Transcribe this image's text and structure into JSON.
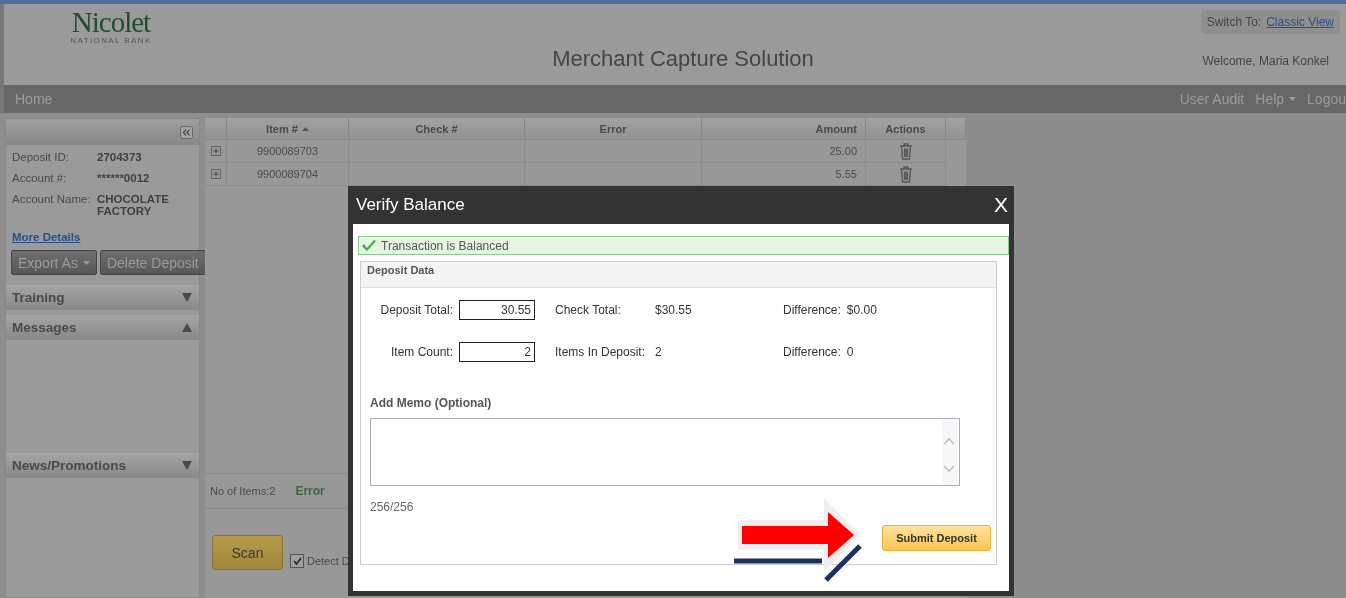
{
  "header": {
    "logo_name": "Nicolet",
    "logo_tagline": "NATIONAL BANK",
    "title": "Merchant Capture Solution",
    "switch_label": "Switch To:",
    "switch_link": "Classic View",
    "welcome": "Welcome, Maria Konkel"
  },
  "nav": {
    "left": [
      {
        "label": "Home",
        "dropdown": false
      }
    ],
    "right": [
      {
        "label": "User Audit",
        "dropdown": false
      },
      {
        "label": "Help",
        "dropdown": true
      },
      {
        "label": "Logou",
        "dropdown": false
      }
    ]
  },
  "deposit": {
    "fields": [
      {
        "label": "Deposit ID:",
        "value": "2704373"
      },
      {
        "label": "Account #:",
        "value": "******0012"
      },
      {
        "label": "Account Name:",
        "value": "CHOCOLATE FACTORY"
      }
    ],
    "link": "More Details",
    "buttons": [
      {
        "label": "Export As",
        "dropdown": true
      },
      {
        "label": "Delete Deposit",
        "dropdown": false
      }
    ]
  },
  "panels": [
    {
      "title": "Training",
      "expanded": false
    },
    {
      "title": "Messages",
      "expanded": true
    },
    {
      "title": "News/Promotions",
      "expanded": false
    }
  ],
  "table": {
    "columns": [
      {
        "label": "Item #",
        "sorted": true
      },
      {
        "label": "Check #",
        "sorted": false
      },
      {
        "label": "Error",
        "sorted": false
      },
      {
        "label": "Amount",
        "sorted": false
      },
      {
        "label": "Actions",
        "sorted": false
      }
    ],
    "rows": [
      {
        "item_no": "9900089703",
        "amount": "25.00"
      },
      {
        "item_no": "9900089704",
        "amount": "5.55"
      }
    ],
    "footer": {
      "count_label": "No of Items:",
      "count": "2",
      "error_label": "Error"
    }
  },
  "scan": {
    "button": "Scan",
    "detect_label": "Detect D",
    "detect_checked": true
  },
  "dialog": {
    "title": "Verify Balance",
    "close": "X",
    "status": "Transaction is Balanced",
    "section": "Deposit Data",
    "rows": [
      {
        "label": "Deposit Total:",
        "input": "30.55",
        "compare_label": "Check Total:",
        "compare_value": "$30.55",
        "diff_label": "Difference:",
        "diff_value": "$0.00"
      },
      {
        "label": "Item Count:",
        "input": "2",
        "compare_label": "Items In Deposit:",
        "compare_value": "2",
        "diff_label": "Difference:",
        "diff_value": "0"
      }
    ],
    "memo_label": "Add Memo (Optional)",
    "memo_counter": "256/256",
    "submit": "Submit Deposit"
  }
}
